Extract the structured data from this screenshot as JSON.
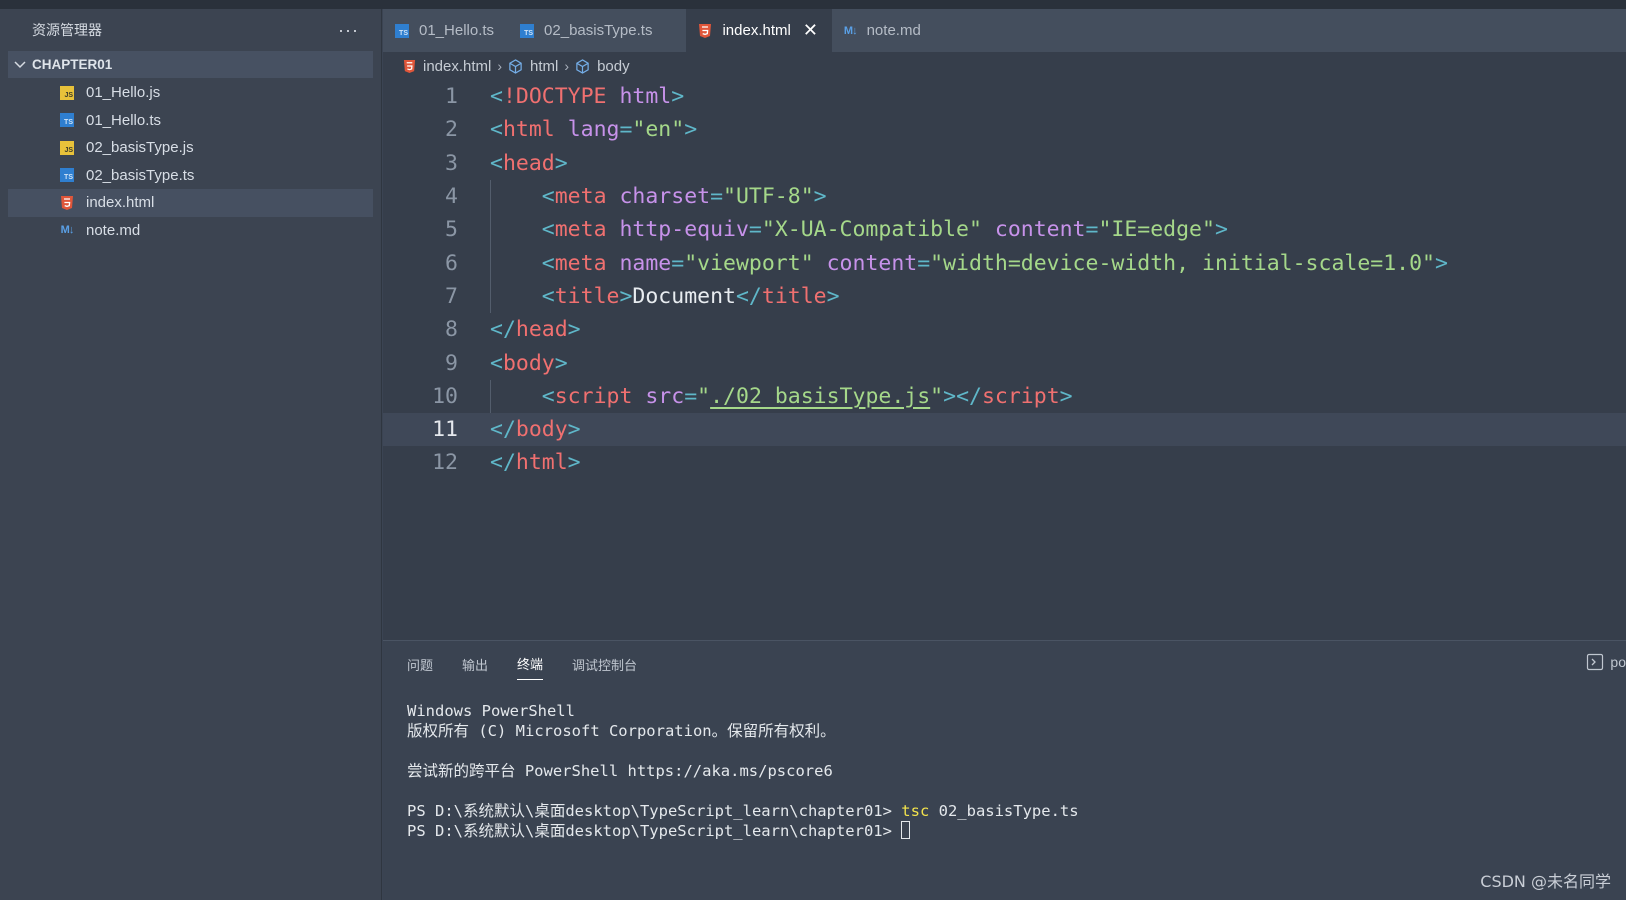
{
  "sidebar": {
    "title": "资源管理器",
    "more": "···",
    "folder": "CHAPTER01",
    "items": [
      {
        "label": "01_Hello.js",
        "icon": "js-file-icon"
      },
      {
        "label": "01_Hello.ts",
        "icon": "ts-file-icon"
      },
      {
        "label": "02_basisType.js",
        "icon": "js-file-icon"
      },
      {
        "label": "02_basisType.ts",
        "icon": "ts-file-icon"
      },
      {
        "label": "index.html",
        "icon": "html-file-icon",
        "active": true
      },
      {
        "label": "note.md",
        "icon": "markdown-file-icon"
      }
    ]
  },
  "tabs": [
    {
      "label": "01_Hello.ts",
      "icon": "ts-file-icon"
    },
    {
      "label": "02_basisType.ts",
      "icon": "ts-file-icon"
    },
    {
      "label": "index.html",
      "icon": "html-file-icon",
      "active": true
    },
    {
      "label": "note.md",
      "icon": "markdown-file-icon"
    }
  ],
  "breadcrumb": [
    "index.html",
    "html",
    "body"
  ],
  "editor": {
    "current_line": 11,
    "lines": [
      "1",
      "2",
      "3",
      "4",
      "5",
      "6",
      "7",
      "8",
      "9",
      "10",
      "11",
      "12"
    ],
    "code": {
      "l1_doctype": "!DOCTYPE",
      "l1_html": "html",
      "l2_tag": "html",
      "l2_attr": "lang",
      "l2_val": "\"en\"",
      "l3_tag": "head",
      "l4_tag": "meta",
      "l4_attr": "charset",
      "l4_val": "\"UTF-8\"",
      "l5_tag": "meta",
      "l5_attr1": "http-equiv",
      "l5_val1": "\"X-UA-Compatible\"",
      "l5_attr2": "content",
      "l5_val2": "\"IE=edge\"",
      "l6_tag": "meta",
      "l6_attr1": "name",
      "l6_val1": "\"viewport\"",
      "l6_attr2": "content",
      "l6_val2": "\"width=device-width, initial-scale=1.0\"",
      "l7_tag": "title",
      "l7_text": "Document",
      "l8_tag": "head",
      "l9_tag": "body",
      "l10_tag": "script",
      "l10_attr": "src",
      "l10_val": "./02_basisType.js",
      "l11_tag": "body",
      "l12_tag": "html"
    }
  },
  "panel": {
    "tabs": [
      "问题",
      "输出",
      "终端",
      "调试控制台"
    ],
    "active_tab": "终端",
    "right_label": "po",
    "terminal": {
      "line1": "Windows PowerShell",
      "line2": "版权所有 (C) Microsoft Corporation。保留所有权利。",
      "line3": "尝试新的跨平台 PowerShell https://aka.ms/pscore6",
      "prompt": "PS D:\\系统默认\\桌面desktop\\TypeScript_learn\\chapter01> ",
      "cmd": "tsc",
      "cmd_arg": " 02_basisType.ts"
    }
  },
  "watermark": "CSDN @未名同学",
  "colors": {
    "accent_tag": "#f07070",
    "accent_attr": "#c792ea",
    "accent_string": "#a5d88a",
    "accent_bracket": "#5fb7c9"
  }
}
